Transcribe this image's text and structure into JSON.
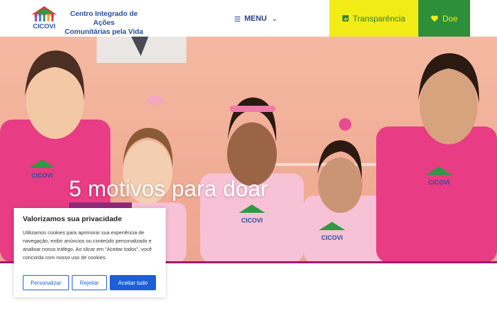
{
  "header": {
    "brand_line1": "Centro Integrado de Ações",
    "brand_line2": "Comunitárias pela Vida",
    "logo_text": "CICOVI",
    "menu_label": "MENU",
    "transparency_label": "Transparência",
    "donate_label": "Doe"
  },
  "hero": {
    "title": "5 motivos para doar",
    "shirt_logo_text": "CICOVI"
  },
  "cookie": {
    "title": "Valorizamos sua privacidade",
    "body": "Utilizamos cookies para aprimorar sua experiência de navegação, exibir anúncios ou conteúdo personalizado e analisar nosso tráfego. Ao clicar em “Aceitar todos”, você concorda com nosso uso de cookies.",
    "customize_label": "Personalizar",
    "reject_label": "Rejeitar",
    "accept_label": "Aceitar tudo"
  },
  "colors": {
    "brand_blue": "#2a4fa0",
    "transparency_bg": "#f2ec16",
    "donate_bg": "#2e8f3a",
    "hero_accent": "#a3196b",
    "cookie_button": "#1c5fd6"
  },
  "icons": {
    "menu": "hamburger-icon",
    "transparency": "chart-icon",
    "donate": "heart-icon"
  }
}
